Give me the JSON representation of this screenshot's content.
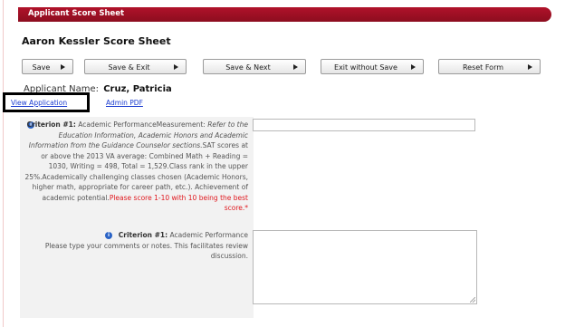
{
  "header": {
    "title": "Applicant Score Sheet"
  },
  "sheet": {
    "title": "Aaron Kessler Score Sheet"
  },
  "toolbar": {
    "buttons": [
      {
        "label": "Save"
      },
      {
        "label": "Save & Exit"
      },
      {
        "label": "Save & Next"
      },
      {
        "label": "Exit without Save"
      },
      {
        "label": "Reset Form"
      }
    ]
  },
  "applicant": {
    "label": "Applicant Name:",
    "name": "Cruz, Patricia"
  },
  "links": {
    "view_application": "View Application",
    "admin_pdf": "Admin PDF"
  },
  "criterion1": {
    "title": "Criterion #1:",
    "heading": "Academic PerformanceMeasurement:",
    "measurement_italic": "Refer to the Education Information, Academic Honors and Academic Information from the Guidance Counselor sections.",
    "details": "SAT scores at or above the 2013 VA average: Combined Math + Reading = 1030, Writing = 498, Total = 1,529.Class rank in the upper 25%.Academically challenging classes chosen (Academic Honors, higher math, appropriate for career path, etc.). Achievement of academic potential.",
    "required_note": "Please score 1-10 with 10 being the best score.*",
    "score_value": ""
  },
  "comments": {
    "title": "Criterion #1:",
    "heading": "Academic Performance",
    "instructions": "Please type your comments or notes. This facilitates review discussion.",
    "value": ""
  },
  "colors": {
    "header_bar": "#9e1024",
    "link": "#1b3cd0",
    "required": "#e0181e",
    "info_icon": "#2a63c6"
  },
  "icons": {
    "info": "info-icon",
    "arrow": "arrow-right-icon"
  }
}
